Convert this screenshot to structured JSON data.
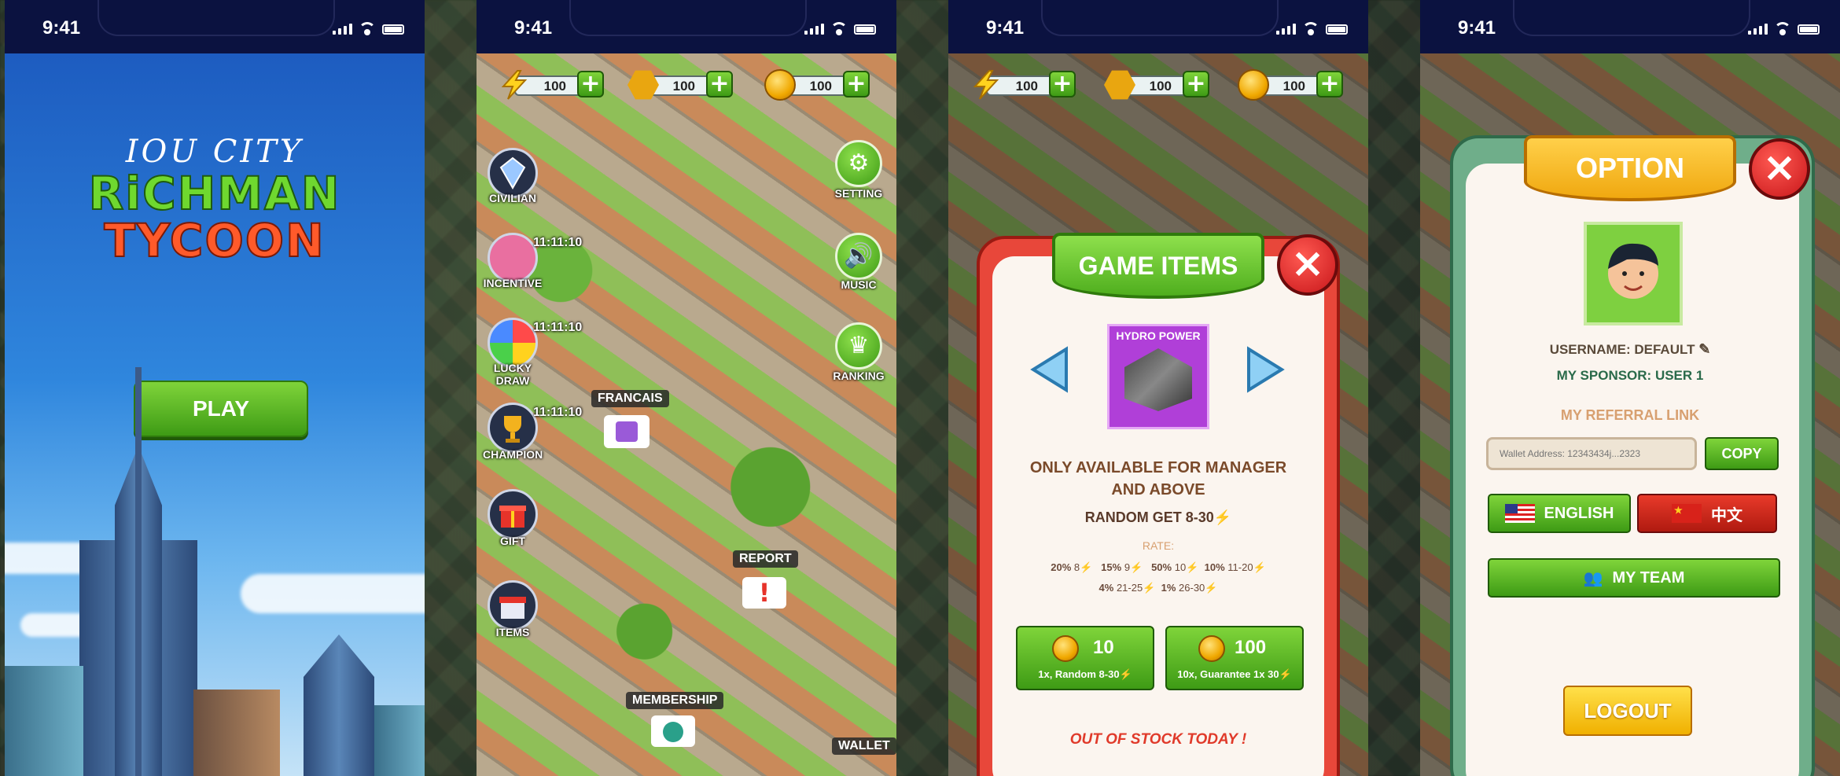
{
  "status": {
    "time": "9:41"
  },
  "splash": {
    "logo_line1": "IOU CITY",
    "logo_line2": "RiCHMAN",
    "logo_line3": "TYCOON",
    "play_label": "PLAY"
  },
  "resources": [
    {
      "icon": "lightning-icon",
      "value": "100"
    },
    {
      "icon": "iou-token-icon",
      "value": "100"
    },
    {
      "icon": "gold-coin-icon",
      "value": "100"
    }
  ],
  "city": {
    "left_menu": [
      {
        "label": "CIVILIAN",
        "icon": "diamond-badge-icon",
        "timer": ""
      },
      {
        "label": "INCENTIVE",
        "icon": "donut-icon",
        "timer": "11:11:10"
      },
      {
        "label": "LUCKY DRAW",
        "icon": "lucky-wheel-icon",
        "timer": "11:11:10"
      },
      {
        "label": "CHAMPION",
        "icon": "trophy-icon",
        "timer": "11:11:10"
      },
      {
        "label": "GIFT",
        "icon": "gift-icon",
        "timer": ""
      },
      {
        "label": "ITEMS",
        "icon": "shop-icon",
        "timer": ""
      }
    ],
    "right_menu": [
      {
        "label": "SETTING",
        "icon": "gear-icon"
      },
      {
        "label": "MUSIC",
        "icon": "speaker-icon"
      },
      {
        "label": "RANKING",
        "icon": "crown-icon"
      }
    ],
    "map_labels": {
      "francais": "FRANCAIS",
      "report": "REPORT",
      "membership": "MEMBERSHIP",
      "wallet": "WALLET"
    }
  },
  "game_items": {
    "title": "GAME ITEMS",
    "item_name": "HYDRO POWER",
    "availability_line1": "ONLY AVAILABLE FOR MANAGER",
    "availability_line2": "AND ABOVE",
    "random_get": "RANDOM GET   8-30",
    "rate_label": "RATE:",
    "rates_row1": [
      {
        "pct": "20%",
        "range": "8"
      },
      {
        "pct": "15%",
        "range": "9"
      },
      {
        "pct": "50%",
        "range": "10"
      },
      {
        "pct": "10%",
        "range": "11-20"
      }
    ],
    "rates_row2": [
      {
        "pct": "4%",
        "range": "21-25"
      },
      {
        "pct": "1%",
        "range": "26-30"
      }
    ],
    "buy_buttons": [
      {
        "price": "10",
        "desc": "1x, Random 8-30"
      },
      {
        "price": "100",
        "desc": "10x, Guarantee 1x 30"
      }
    ],
    "out_of_stock": "OUT OF STOCK TODAY !"
  },
  "option": {
    "title": "OPTION",
    "username": "USERNAME: DEFAULT",
    "sponsor": "MY SPONSOR: USER 1",
    "referral_title": "MY REFERRAL LINK",
    "wallet_placeholder": "Wallet Address: 12343434j...2323",
    "copy_label": "COPY",
    "english_label": "ENGLISH",
    "chinese_label": "中文",
    "team_label": "MY TEAM",
    "logout_label": "LOGOUT"
  }
}
